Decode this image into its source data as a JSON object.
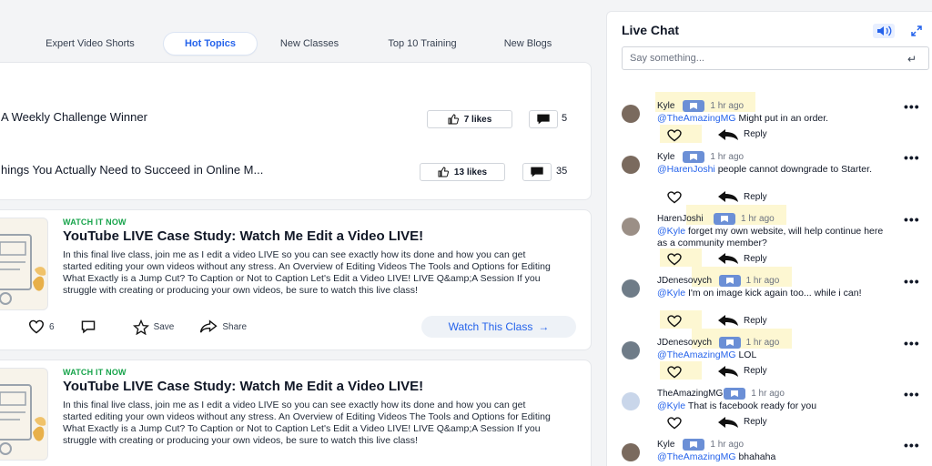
{
  "tabs": [
    {
      "label": "Expert Video Shorts",
      "active": false
    },
    {
      "label": "Hot Topics",
      "active": true
    },
    {
      "label": "New Classes",
      "active": false
    },
    {
      "label": "Top 10 Training",
      "active": false
    },
    {
      "label": "New Blogs",
      "active": false
    }
  ],
  "topics": [
    {
      "title": "A Weekly Challenge Winner",
      "likes": "7 likes",
      "comments": "5"
    },
    {
      "title": "hings You Actually Need to Succeed in Online M...",
      "likes": "13 likes",
      "comments": "35"
    }
  ],
  "videos": [
    {
      "tag": "WATCH IT NOW",
      "title": "YouTube LIVE Case Study: Watch Me Edit a Video LIVE!",
      "desc": "In this final live class, join me as I edit a video LIVE so you can see exactly how its done and how you can get started editing your own videos without any stress. An Overview of Editing Videos The Tools and Options for Editing What Exactly is a Jump Cut? To Caption or Not to Caption Let's Edit a Video LIVE! LIVE Q&amp;A Session If you struggle with creating or producing your own videos, be sure to watch this live class!",
      "likes": "6",
      "save": "Save",
      "share": "Share",
      "watch": "Watch This Class"
    },
    {
      "tag": "WATCH IT NOW",
      "title": "YouTube LIVE Case Study: Watch Me Edit a Video LIVE!",
      "desc": "In this final live class, join me as I edit a video LIVE so you can see exactly how its done and how you can get started editing your own videos without any stress. An Overview of Editing Videos The Tools and Options for Editing What Exactly is a Jump Cut? To Caption or Not to Caption Let's Edit a Video LIVE! LIVE Q&amp;A Session If you struggle with creating or producing your own videos, be sure to watch this live class!"
    }
  ],
  "chat": {
    "title": "Live Chat",
    "placeholder": "Say something...",
    "reply_label": "Reply",
    "messages": [
      {
        "user": "Kyle",
        "time": "1 hr ago",
        "mention": "@TheAmazingMG",
        "text": " Might put in an order."
      },
      {
        "user": "Kyle",
        "time": "1 hr ago",
        "mention": "@HarenJoshi",
        "text": " people cannot downgrade to Starter."
      },
      {
        "user": "HarenJoshi",
        "time": "1 hr ago",
        "mention": "@Kyle",
        "text": " forget my own website, will help continue here as a community member?"
      },
      {
        "user": "JDenesovych",
        "time": "1 hr ago",
        "mention": "@Kyle",
        "text": " I'm on image kick again too... while i can!"
      },
      {
        "user": "JDenesovych",
        "time": "1 hr ago",
        "mention": "@TheAmazingMG",
        "text": " LOL"
      },
      {
        "user": "TheAmazingMG",
        "time": "1 hr ago",
        "mention": "@Kyle",
        "text": " That is facebook ready for you"
      },
      {
        "user": "Kyle",
        "time": "1 hr ago",
        "mention": "@TheAmazingMG",
        "text": " bhahaha"
      }
    ]
  },
  "colors": {
    "accent": "#2563eb",
    "tag_green": "#16a34a",
    "highlight": "#fdf7d2"
  }
}
